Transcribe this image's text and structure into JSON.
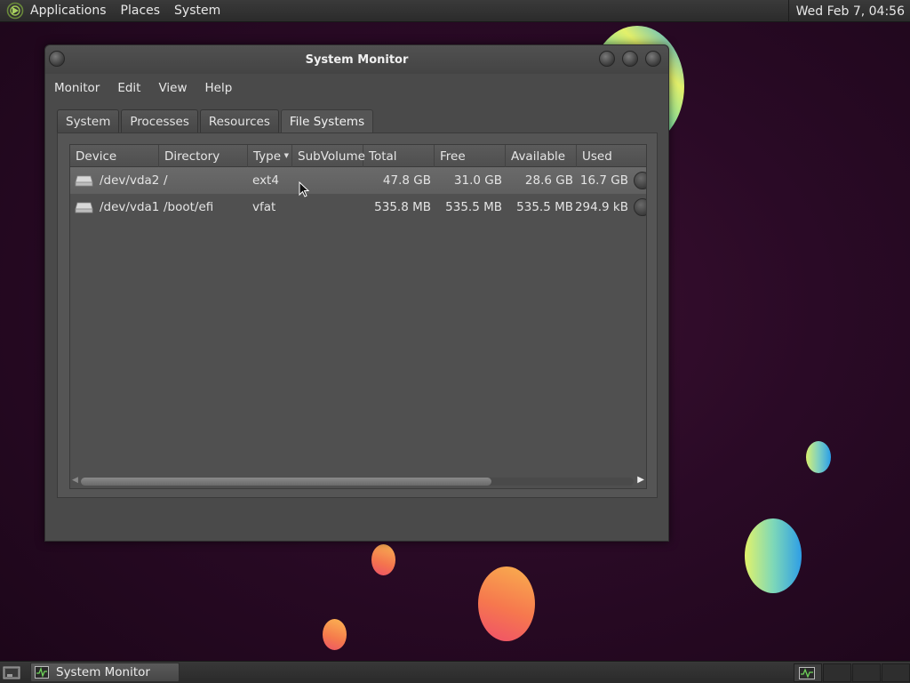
{
  "top_panel": {
    "menus": [
      "Applications",
      "Places",
      "System"
    ],
    "clock": "Wed Feb  7, 04:56"
  },
  "window": {
    "title": "System Monitor",
    "menubar": [
      "Monitor",
      "Edit",
      "View",
      "Help"
    ],
    "tabs": [
      "System",
      "Processes",
      "Resources",
      "File Systems"
    ],
    "active_tab": "File Systems",
    "table": {
      "columns": [
        "Device",
        "Directory",
        "Type",
        "SubVolume",
        "Total",
        "Free",
        "Available",
        "Used"
      ],
      "sorted_column": "Type",
      "rows": [
        {
          "device": "/dev/vda2",
          "directory": "/",
          "type": "ext4",
          "subvolume": "",
          "total": "47.8 GB",
          "free": "31.0 GB",
          "available": "28.6 GB",
          "used": "16.7 GB",
          "icon": "drive-icon"
        },
        {
          "device": "/dev/vda1",
          "directory": "/boot/efi",
          "type": "vfat",
          "subvolume": "",
          "total": "535.8 MB",
          "free": "535.5 MB",
          "available": "535.5 MB",
          "used": "294.9 kB",
          "icon": "drive-icon"
        }
      ],
      "selected_row": 0
    }
  },
  "taskbar": {
    "tasks": [
      {
        "label": "System Monitor",
        "icon": "system-monitor-icon"
      }
    ],
    "workspaces": 4,
    "active_workspace": 1
  }
}
